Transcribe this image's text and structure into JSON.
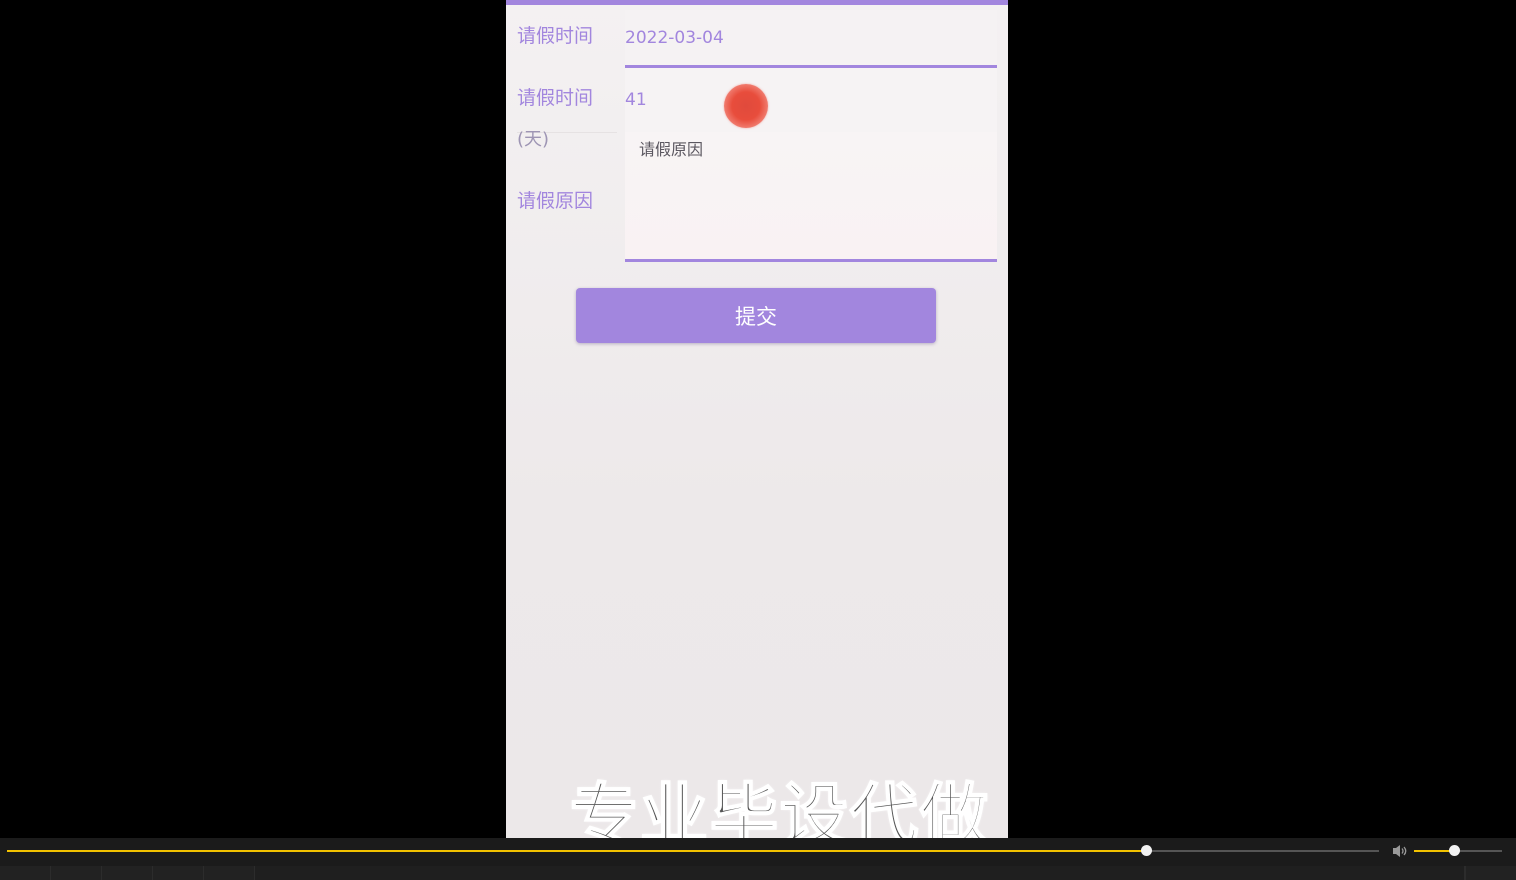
{
  "colors": {
    "accent": "#a286de",
    "progress": "#f2c200"
  },
  "form": {
    "date_label": "请假时间",
    "date_value": "2022-03-04",
    "days_label": "请假时间",
    "days_unit": "(天)",
    "days_value": "41",
    "reason_label": "请假原因",
    "reason_placeholder": "请假原因",
    "submit_label": "提交"
  },
  "watermark": "专业毕设代做",
  "player": {
    "progress": 0.83,
    "volume": 0.45,
    "volume_icon": "speaker-icon"
  }
}
